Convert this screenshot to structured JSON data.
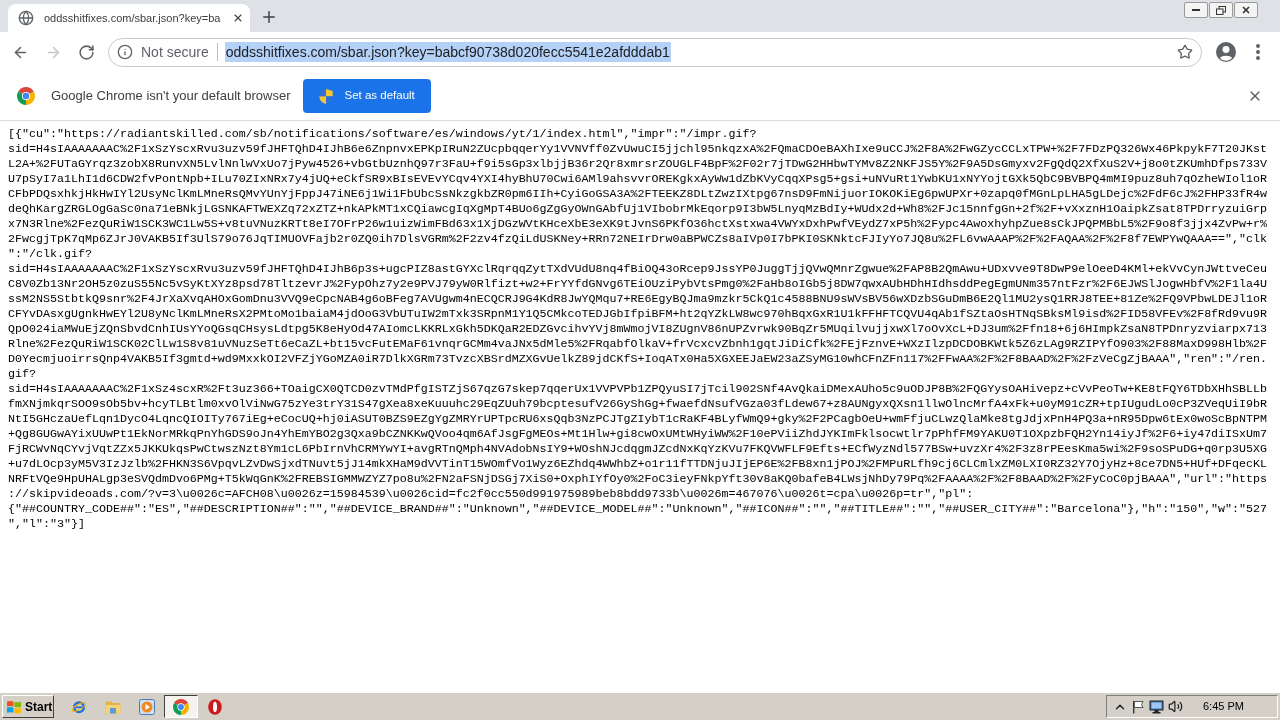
{
  "browser": {
    "tabs": [
      {
        "title": "oddsshitfixes.com/sbar.json?key=ba",
        "selected": true
      }
    ],
    "nav_buttons": [
      {
        "kind": "back",
        "disabled": false
      },
      {
        "kind": "forward",
        "disabled": true
      },
      {
        "kind": "reload",
        "disabled": false
      }
    ],
    "address_bar": {
      "security_label": "Not secure",
      "url": "oddsshitfixes.com/sbar.json?key=babcf90738d020fecc5541e2afdddab1",
      "url_selected": true
    },
    "infobar": {
      "message": "Google Chrome isn't your default browser",
      "button": "Set as default"
    }
  },
  "page": {
    "lines": [
      "[{\"cu\":\"https://radiantskilled.com/sb/notifications/software/es/windows/yt/1/index.html\",\"impr\":\"/impr.gif?",
      "sid=H4sIAAAAAAAC%2F1xSzYscxRvu3uzv59fJHFTQhD4IJhB6e6ZnpnvxEPKpIRuN2ZUcpbqqerYy1VVNVff0ZvUwuCI5jjchl95nkqzxA%2FQmaCDOeBAXhIxe9uCCJ%2F8A%2FwGZycCCLxTPW+%2F7FDzPQ326Wx46PkpykF7T20JKst",
      "L2A+%2FUTaGYrqz3zobX8RunvXN5LvlNnlwVxUo7jPyw4526+vbGtbUznhQ97r3FaU+f9i5sGp3xlbjjB36r2Qr8xmrsrZOUGLF4BpF%2F02r7jTDwG2HHbwTYMv8Z2NKFJS5Y%2F9A5DsGmyxv2FgQdQ2XfXuS2V+j8o0tZKUmhDfps733V",
      "U7pSyI7a1LhI1d6CDW2fvPontNpb+ILu70ZIxNRx7y4jUQ+eCkfSR9xBIsEVEvYCqv4YXI4hyBhU70Cwi6AMl9ahsvvrOREKgkxAyWw1dZbKVyCqqXPsg5+gsi+uNVuRt1YwbKU1xNYYojtGXk5QbC9BVBPQ4mMI9puz8uh7qOzheWIol1oR",
      "CFbPDQsxhkjHkHwIYl2UsyNclKmLMneRsQMvYUnYjFppJ47iNE6j1Wi1FbUbcSsNkzgkbZR0pm6IIh+CyiGoGSA3A%2FTEEKZ8DLtZwzIXtpg67nsD9FmNijuorIOKOKiEg6pwUPXr+0zapq0fMGnLpLHA5gLDejc%2FdF6cJ%2FHP33fR4w",
      "deQhKargZRGLOgGaSc0na71eBNkjLGSNKAFTWEXZq72xZTZ+nkAPkMT1xCQiawcgIqXgMpT4BUo6gZgGyOWnGAbfUj1VIbobrMkEqorp9I3bW5LnyqMzBdIy+WUdx2d+Wh8%2FJc15nnfgGn+2f%2F+vXxznH1OaipkZsat8TPDrryzuiGrp",
      "x7N3Rlne%2FezQuRiW1SCK3WC1Lw5S+v8tuVNuzKRTt8eI7OFrP26w1uizWimFBd63x1XjDGzWVtKHceXbE3eXK9tJvnS6PKfO36hctXstxwa4VWYxDxhPwfVEydZ7xP5h%2Fypc4AwoxhyhpZue8sCkJPQPMBbL5%2F9o8f3jjx4ZvPw+r%",
      "2FwcgjTpK7qMp6ZJrJ0VAKB5If3UlS79o76JqTIMUOVFajb2r0ZQ0ih7DlsVGRm%2F2zv4fzQiLdUSKNey+RRn72NEIrDrw0aBPWCZs8aIVp0I7bPKI0SKNktcFJIyYo7JQ8u%2FL6vwAAAP%2F%2FAQAA%2F%2F8f7EWPYwQAAA==\",\"clk",
      "\":\"/clk.gif?",
      "sid=H4sIAAAAAAAC%2F1xSzYscxRvu3uzv59fJHFTQhD4IJhB6p3s+ugcPIZ8astGYXclRqrqqZytTXdVUdU8nq4fBiOQ43oRcep9JssYP0JuggTjjQVwQMnrZgwue%2FAP8B2QmAwu+UDxvve9T8DwP9elOeeD4KMl+ekVvCynJWttveCeu",
      "C8V0Zb13Nr2OH5z0zuS55Nc5vSyKtXYz8psd78TltzevrJ%2FypOhz7y2e9PVJ79yW0Rlfizt+w2+FrYYfdGNvg6TEiOUziPybVtsPmg0%2FaHb8oIGb5j8DW7qwxAUbHDhHIdhsddPegEgmUNm357ntFzr%2F6EJWSlJogwHbfV%2F1la4U",
      "ssM2NS5StbtkQ9snr%2F4JrXaXvqAHOxGomDnu3VVQ9eCpcNAB4g6oBFeg7AVUgwm4nECQCRJ9G4KdR8JwYQMqu7+RE6EgyBQJma9mzkr5CkQ1c4588BNU9sWVsBV56wXDzbSGuDmB6E2Ql1MU2ysQ1RRJ8TEE+81Ze%2FQ9VPbwLDEJl1oR",
      "CFYvDAsxgUgnkHwEYl2U8yNclKmLMneRsX2PMtoMo1baiaM4jdOoG3VbUTuIW2mTxk3SRpnM1Y1Q5CMkcoTEDJGbIfpiBFM+ht2qYZkLW8wc970hBqxGxR1U1kFFHFTCQVU4qAb1fSZtaOsHTNqSBksMl9isd%2FID58VFEv%2F8fRd9vu9R",
      "QpO024iaMWuEjZQnSbvdCnhIUsYYoQGsqCHsysLdtpg5K8eHyOd47AIomcLKKRLxGkh5DKQaR2EDZGvcihvYVj8mWmojVI8ZUgnV86nUPZvrwk90BqZr5MUqilvujjxwXl7oOvXcL+DJ3um%2Ffn18+6j6HImpkZsaN8TPDnryzviarpx713",
      "Rlne%2FezQuRiW1SCK02ClLw1S8v81uVNuzSeTt6eCaZL+bt15vcFutEMaF61vnqrGCMm4vaJNx5dMle5%2FRqabfOlkaV+frVcxcvZbnh1gqtJiDiCfk%2FEjFznvE+WXzIlzpDCDOBKWtk5Z6zLAg9RZIPYfO903%2F88MaxD998Hlb%2F",
      "D0YecmjuoirrsQnp4VAKB5If3gmtd+wd9MxxkOI2VFZjYGoMZA0iR7DlkXGRm73TvzcXBSrdMZXGvUelkZ89jdCKfS+IoqATx0Ha5XGXEEJaEW23aZSyMG10whCFnZFn117%2FFwAA%2F%2F8BAAD%2F%2FzVeCgZjBAAA\",\"ren\":\"/ren.",
      "gif?",
      "sid=H4sIAAAAAAAC%2F1xSz4scxR%2Ft3uz366+TOaigCX0QTCD0zvTMdPfgISTZjS67qzG7skep7qqerUx1VVPVPb1ZPQyuSI7jTcil902SNf4AvQkaiDMexAUho5c9uODJP8B%2FQGYysOAHivepz+cVvPeoTw+KE8tFQY6TDbXHhSBLLb",
      "fmXNjmkqrSOO9sOb5bv+hcyTLBtlm0xvOlViNwG75zYe3trY31S47gXea8xeKuuuhc29EqZUuh79bcptesufV26GyShGg+fwaefdNsufVGza03fLdew67+z8AUNgyxQXsn1llwOlncMrfA4xFk+u0yM91cZR+tpIUgudLo0cP3ZVeqUiI9bR",
      "NtI5GHczaUefLqn1DycO4LqncQIOITy767iEg+eCocUQ+hj0iASUT0BZS9EZgYgZMRYrUPTpcRU6xsQqb3NzPCJTgZIybT1cRaKF4BLyfWmQ9+gky%2F2PCagbOeU+wmFfjuCLwzQlaMke8tgJdjxPnH4PQ3a+nR95Dpw6tEx0woScBpNTPM",
      "+Qg8GUGwAYixUUwPt1EkNorMRkqPnYhGDS9oJn4YhEmYBO2g3Qxa9bCZNKKwQVoo4qm6AfJsgFgMEOs+Mt1Hlw+gi8cwOxUMtWHyiWW%2F10ePViiZhdJYKImFklsocwtlr7pPhfFM9YAKU0T1OXpzbFQH2Yn14iyJf%2F6+iy47diISxUm7",
      "FjRCWvNqCYvjVqtZZx5JKKUkqsPwCtwszNzt8Ym1cL6PbIrnVhCRMYwYI+avgRTnQMph4NVAdobNsIY9+WOshNJcdqgmJZcdNxKqYzKVu7FKQVWFLF9Efts+ECfWyzNdl577BSw+uvzXr4%2F3z8rPEesKma5wi%2F9soSPuDG+q0rp3U5XG",
      "+u7dLOcp3yM5V3IzJzlb%2FHKN3S6VpqvLZvDwSjxdTNuvt5jJ14mkXHaM9dVVTinT15WOmfVo1Wyz6EZhdq4WWhbZ+o1r11fTTDNjuJIjEP6E%2FB8xn1jPOJ%2FMPuRLfh9cj6CLCmlxZM0LXI0RZ32Y7OjyHz+8ce7DN5+HUf+DFqecKL",
      "NRFtVQe9HpUHALgp3eSVQdmDvo6PMg+T5kWqGnK%2FREBSIGMMWZYZ7po8u%2FN2aFSNjDSGj7XiS0+OxphIYfOy0%2FoC3ieyFNkpYft30v8aKQ0bafeB4LWsjNhDy79Pq%2FAAAA%2F%2F8BAAD%2F%2FyCoC0pjBAAA\",\"url\":\"https",
      "://skipvideoads.com/?v=3\\u0026c=AFCH08\\u0026z=15984539\\u0026cid=fc2f0cc550d991975989beb8bdd9733b\\u0026m=467076\\u0026t=cpa\\u0026p=tr\",\"pl\":",
      "{\"##COUNTRY_CODE##\":\"ES\",\"##DESCRIPTION##\":\"\",\"##DEVICE_BRAND##\":\"Unknown\",\"##DEVICE_MODEL##\":\"Unknown\",\"##ICON##\":\"\",\"##TITLE##\":\"\",\"##USER_CITY##\":\"Barcelona\"},\"h\":\"150\",\"w\":\"527",
      "\",\"l\":\"3\"}]"
    ]
  },
  "taskbar": {
    "start": "Start",
    "apps": [
      {
        "kind": "ie",
        "selected": false
      },
      {
        "kind": "folder",
        "selected": false
      },
      {
        "kind": "media",
        "selected": false
      },
      {
        "kind": "chrome",
        "selected": true
      },
      {
        "kind": "ring",
        "selected": false
      }
    ],
    "clock": "6:45 PM"
  }
}
